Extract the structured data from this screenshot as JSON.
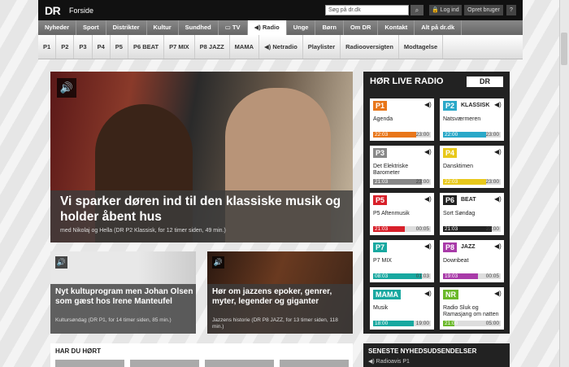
{
  "topbar": {
    "logo": "DR",
    "logo_sub": "Forside",
    "search_placeholder": "Søg på dr.dk",
    "login": "Log ind",
    "register": "Opret bruger",
    "help": "?"
  },
  "mainnav": [
    "Nyheder",
    "Sport",
    "Distrikter",
    "Kultur",
    "Sundhed",
    "TV",
    "Radio",
    "Unge",
    "Børn",
    "Om DR",
    "Kontakt",
    "Alt på dr.dk"
  ],
  "subnav": [
    "P1",
    "P2",
    "P3",
    "P4",
    "P5",
    "P6 BEAT",
    "P7 MIX",
    "P8 JAZZ",
    "MAMA",
    "Netradio",
    "Playlister",
    "Radiooversigten",
    "Modtagelse"
  ],
  "hero": {
    "title": "Vi sparker døren ind til den klassiske musik og holder åbent hus",
    "meta": "med Nikolaj og Hella (DR P2 Klassisk, for 12 timer siden, 49 min.)"
  },
  "tiles": [
    {
      "title": "Nyt kultuprogram men Johan Olsen som gæst hos Irene Manteufel",
      "meta": "Kultursøndag (DR P1, for 14 timer siden, 85 min.)"
    },
    {
      "title": "Hør om jazzens epoker, genrer, myter, legender og giganter",
      "meta": "Jazzens historie (DR P8 JAZZ, for 13 timer siden, 118 min.)"
    }
  ],
  "har_du_hort": {
    "title": "HAR DU HØRT"
  },
  "live": {
    "title": "HØR LIVE RADIO",
    "logo": "DR",
    "channels": [
      {
        "badge": "P1",
        "badge_extra": "",
        "color": "#e8761a",
        "show": "Agenda",
        "start": "22:03",
        "end": "23:00",
        "progress": 0.75
      },
      {
        "badge": "P2",
        "badge_extra": "KLASSISK",
        "color": "#2aa8c8",
        "show": "Natsværmeren",
        "start": "22:00",
        "end": "23:00",
        "progress": 0.75
      },
      {
        "badge": "P3",
        "badge_extra": "",
        "color": "#888888",
        "show": "Det Elektriske Barometer",
        "start": "21:03",
        "end": "23:00",
        "progress": 0.85
      },
      {
        "badge": "P4",
        "badge_extra": "",
        "color": "#e8c81a",
        "show": "Dansktimen",
        "start": "22:03",
        "end": "23:00",
        "progress": 0.75
      },
      {
        "badge": "P5",
        "badge_extra": "",
        "color": "#d8202a",
        "show": "P5 Aftenmusik",
        "start": "21:03",
        "end": "00:05",
        "progress": 0.55
      },
      {
        "badge": "P6",
        "badge_extra": "BEAT",
        "color": "#222222",
        "show": "Sort Søndag",
        "start": "21:03",
        "end": "23:00",
        "progress": 0.85
      },
      {
        "badge": "P7",
        "badge_extra": "",
        "color": "#18a8a0",
        "show": "P7 MIX",
        "start": "08:03",
        "end": "01:03",
        "progress": 0.85
      },
      {
        "badge": "P8",
        "badge_extra": "JAZZ",
        "color": "#a83aa8",
        "show": "Downbeat",
        "start": "19:03",
        "end": "00:05",
        "progress": 0.6
      },
      {
        "badge": "MAMA",
        "badge_extra": "",
        "color": "#18a8a0",
        "show": "Musik",
        "start": "18:00",
        "end": "19:00",
        "progress": 0.7
      },
      {
        "badge": "NR",
        "badge_extra": "",
        "color": "#6ab82a",
        "show": "Radio Sluk og Ramasjang om natten",
        "start": "21:00",
        "end": "05:00",
        "progress": 0.2
      }
    ]
  },
  "news": {
    "title": "SENESTE NYHEDSUDSENDELSER",
    "item": "Radioavis P1"
  }
}
